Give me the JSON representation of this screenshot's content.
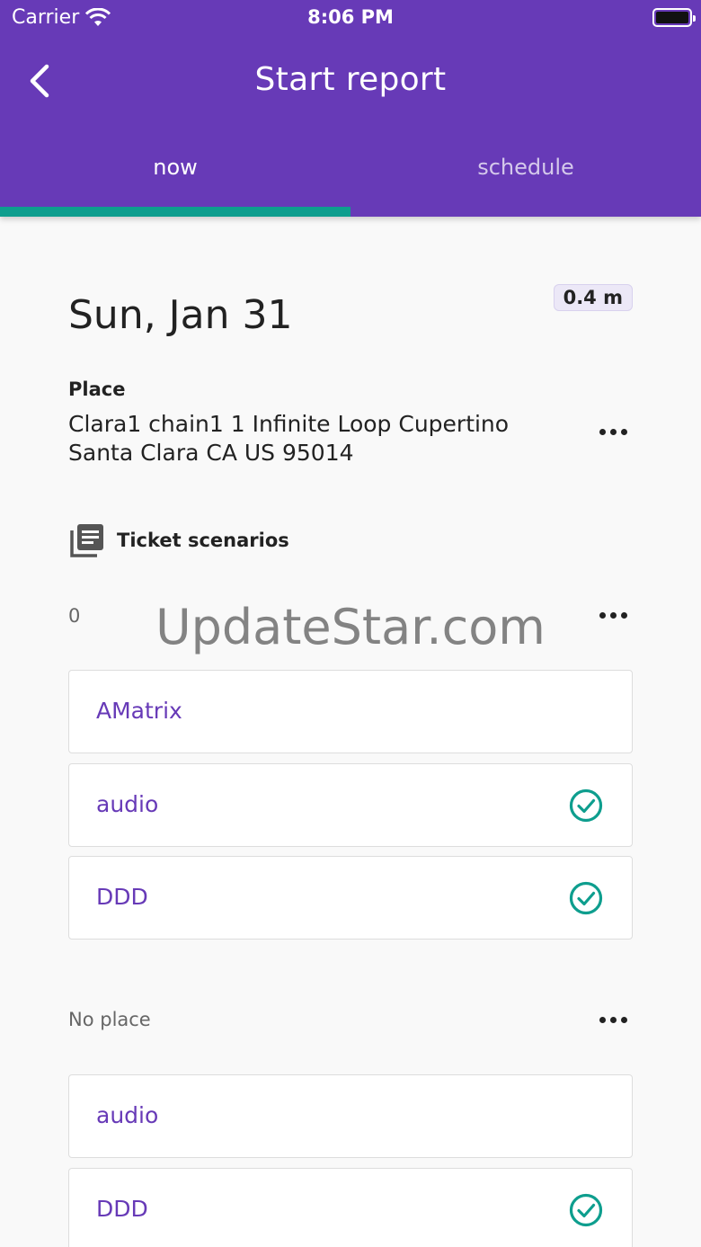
{
  "status_bar": {
    "carrier": "Carrier",
    "time": "8:06 PM"
  },
  "header": {
    "title": "Start report"
  },
  "tabs": [
    {
      "label": "now",
      "selected": true
    },
    {
      "label": "schedule",
      "selected": false
    }
  ],
  "date": "Sun, Jan 31",
  "distance": "0.4 m",
  "place": {
    "label": "Place",
    "address": "Clara1 chain1 1 Infinite Loop Cupertino Santa Clara CA US 95014"
  },
  "ticket_scenarios": {
    "label": "Ticket scenarios"
  },
  "groups": [
    {
      "label": "0",
      "items": [
        {
          "name": "AMatrix",
          "checked": false
        },
        {
          "name": "audio",
          "checked": true
        },
        {
          "name": "DDD",
          "checked": true
        }
      ]
    },
    {
      "label": "No  place",
      "items": [
        {
          "name": "audio",
          "checked": false
        },
        {
          "name": "DDD",
          "checked": true
        }
      ]
    }
  ],
  "watermark": "UpdateStar.com",
  "colors": {
    "primary": "#673ab7",
    "accent": "#0e9e8e"
  },
  "icons": {
    "back": "chevron-left-icon",
    "more": "more-horiz-icon",
    "tickets": "library-books-icon",
    "check": "check-circle-icon"
  }
}
